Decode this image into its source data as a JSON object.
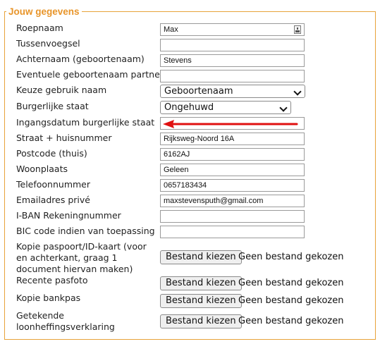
{
  "legend": "Jouw gegevens",
  "fields": {
    "roepnaam": {
      "label": "Roepnaam",
      "value": "Max"
    },
    "tussenvoegsel": {
      "label": "Tussenvoegsel",
      "value": ""
    },
    "achternaam": {
      "label": "Achternaam (geboortenaam)",
      "value": "Stevens"
    },
    "partner": {
      "label": "Eventuele geboortenaam partner",
      "value": ""
    },
    "keuze": {
      "label": "Keuze gebruik naam",
      "value": "Geboortenaam"
    },
    "burgerlijke": {
      "label": "Burgerlijke staat",
      "value": "Ongehuwd"
    },
    "ingangsdatum": {
      "label": "Ingangsdatum burgerlijke staat",
      "value": ""
    },
    "straat": {
      "label": "Straat + huisnummer",
      "value": "Rijksweg-Noord 16A"
    },
    "postcode": {
      "label": "Postcode (thuis)",
      "value": "6162AJ"
    },
    "woonplaats": {
      "label": "Woonplaats",
      "value": "Geleen"
    },
    "telefoon": {
      "label": "Telefoonnummer",
      "value": "0657183434"
    },
    "email": {
      "label": "Emailadres privé",
      "value": "maxstevensputh@gmail.com"
    },
    "iban": {
      "label": "I-BAN Rekeningnummer",
      "value": ""
    },
    "bic": {
      "label": "BIC code indien van toepassing",
      "value": ""
    }
  },
  "uploads": {
    "paspoort": {
      "label_lines": [
        "Kopie paspoort/ID-kaart (voor",
        "en achterkant, graag 1",
        "document hiervan maken)"
      ]
    },
    "pasfoto": {
      "label": "Recente pasfoto"
    },
    "bankpas": {
      "label": "Kopie bankpas"
    },
    "loonheffing": {
      "label_lines": [
        "Getekende",
        "loonheffingsverklaring"
      ]
    },
    "button_label": "Bestand kiezen",
    "status": "Geen bestand gekozen"
  },
  "icons": {
    "autofill": "key-icon",
    "annotation": "red-arrow"
  },
  "colors": {
    "accent": "#e8952a",
    "arrow": "#e01010"
  }
}
